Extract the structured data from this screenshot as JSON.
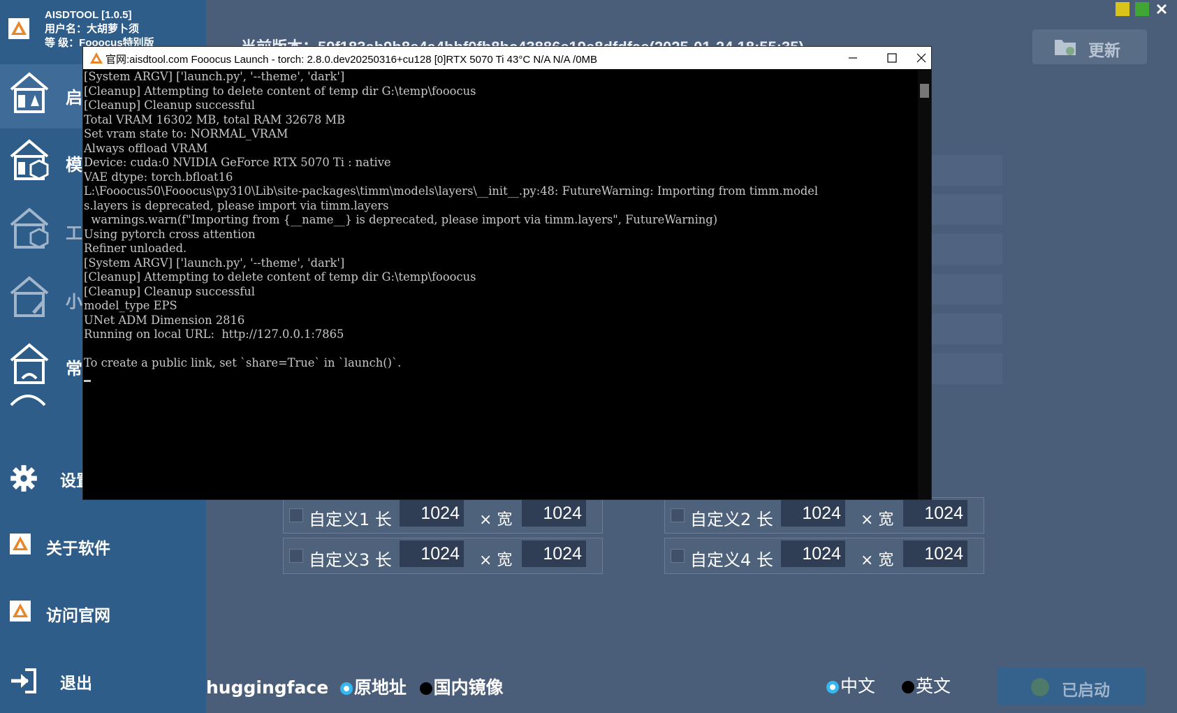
{
  "app": {
    "title": "AISDTOOL [1.0.5]",
    "user_line": "用户名：大胡萝卜须",
    "level_line": "等   级：Fooocus特别版"
  },
  "sidebar": {
    "nav": [
      {
        "label": "启"
      },
      {
        "label": "模"
      },
      {
        "label": "工"
      },
      {
        "label": "小"
      },
      {
        "label": "常"
      }
    ],
    "settings_label": "设置",
    "about_label": "关于软件",
    "website_label": "访问官网",
    "exit_label": "退出"
  },
  "header": {
    "version_text": "当前版本：59f183ab9b8e4a4bbf0fb8bc43886e19e8dfdfae(2025-01-24 18:55:35)",
    "update_label": "更新"
  },
  "custom_sizes": [
    {
      "label": "自定义1 长",
      "length": "1024",
      "width_label": "× 宽",
      "width": "1024"
    },
    {
      "label": "自定义2 长",
      "length": "1024",
      "width_label": "× 宽",
      "width": "1024"
    },
    {
      "label": "自定义3 长",
      "length": "1024",
      "width_label": "× 宽",
      "width": "1024"
    },
    {
      "label": "自定义4 长",
      "length": "1024",
      "width_label": "× 宽",
      "width": "1024"
    }
  ],
  "footer": {
    "hf_label": "huggingface",
    "hf_options": [
      "原地址",
      "国内镜像"
    ],
    "lang_options": [
      "中文",
      "英文"
    ],
    "start_label": "已启动"
  },
  "console": {
    "title": "官网:aisdtool.com     Fooocus Launch - torch: 2.8.0.dev20250316+cu128     [0]RTX 5070 Ti 43°C N/A N/A /0MB",
    "lines": [
      "[System ARGV] ['launch.py', '--theme', 'dark']",
      "[Cleanup] Attempting to delete content of temp dir G:\\temp\\fooocus",
      "[Cleanup] Cleanup successful",
      "Total VRAM 16302 MB, total RAM 32678 MB",
      "Set vram state to: NORMAL_VRAM",
      "Always offload VRAM",
      "Device: cuda:0 NVIDIA GeForce RTX 5070 Ti : native",
      "VAE dtype: torch.bfloat16",
      "L:\\Fooocus50\\Fooocus\\py310\\Lib\\site-packages\\timm\\models\\layers\\__init__.py:48: FutureWarning: Importing from timm.model",
      "s.layers is deprecated, please import via timm.layers",
      "  warnings.warn(f\"Importing from {__name__} is deprecated, please import via timm.layers\", FutureWarning)",
      "Using pytorch cross attention",
      "Refiner unloaded.",
      "[System ARGV] ['launch.py', '--theme', 'dark']",
      "[Cleanup] Attempting to delete content of temp dir G:\\temp\\fooocus",
      "[Cleanup] Cleanup successful",
      "model_type EPS",
      "UNet ADM Dimension 2816",
      "Running on local URL:  http://127.0.0.1:7865",
      "",
      "To create a public link, set `share=True` in `launch()`."
    ]
  }
}
